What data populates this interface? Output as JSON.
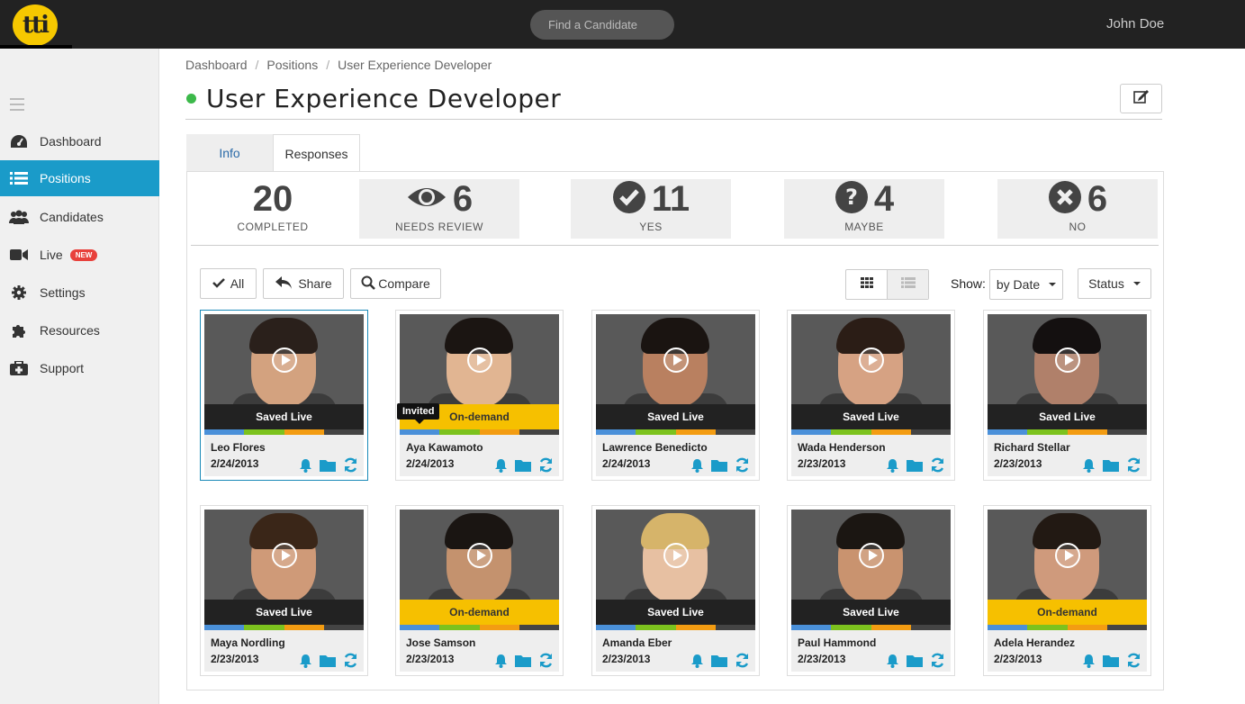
{
  "app": {
    "logo_text": "tti",
    "search_placeholder": "Find a Candidate",
    "user_name": "John Doe"
  },
  "sidebar": {
    "items": [
      {
        "label": "Dashboard",
        "icon": "dashboard-icon"
      },
      {
        "label": "Positions",
        "icon": "list-icon",
        "active": true
      },
      {
        "label": "Candidates",
        "icon": "users-icon"
      },
      {
        "label": "Live",
        "icon": "video-camera-icon",
        "badge": "NEW"
      },
      {
        "label": "Settings",
        "icon": "gear-icon"
      },
      {
        "label": "Resources",
        "icon": "puzzle-icon"
      },
      {
        "label": "Support",
        "icon": "medkit-icon"
      }
    ]
  },
  "breadcrumb": [
    "Dashboard",
    "Positions",
    "User Experience Developer"
  ],
  "page": {
    "title": "User Experience Developer",
    "status_color": "#3cb94a"
  },
  "tabs": [
    {
      "label": "Info"
    },
    {
      "label": "Responses",
      "active": true
    }
  ],
  "stats": [
    {
      "num": "20",
      "label": "COMPLETED"
    },
    {
      "num": "6",
      "label": "NEEDS REVIEW",
      "icon": "eye-icon"
    },
    {
      "num": "11",
      "label": "YES",
      "icon": "check-circle-icon"
    },
    {
      "num": "4",
      "label": "MAYBE",
      "icon": "question-circle-icon"
    },
    {
      "num": "6",
      "label": "NO",
      "icon": "x-circle-icon"
    }
  ],
  "toolbar": {
    "all_label": "All",
    "share_label": "Share",
    "compare_label": "Compare",
    "show_label": "Show:",
    "sort_value": "by Date",
    "status_label": "Status"
  },
  "colors": {
    "accent": "#1a9bc9",
    "stripe": [
      "#4a90d9",
      "#7cc21e",
      "#f39c12",
      "#444444"
    ],
    "on_demand": "#f6c000",
    "saved_live": "#222222",
    "icon": "#1a9bc9"
  },
  "tooltip": "Invited",
  "candidates": [
    {
      "name": "Leo Flores",
      "date": "2/24/2013",
      "status": "Saved Live",
      "type": "live"
    },
    {
      "name": "Aya Kawamoto",
      "date": "2/24/2013",
      "status": "On-demand",
      "type": "ondemand"
    },
    {
      "name": "Lawrence Benedicto",
      "date": "2/24/2013",
      "status": "Saved Live",
      "type": "live"
    },
    {
      "name": "Wada Henderson",
      "date": "2/23/2013",
      "status": "Saved Live",
      "type": "live"
    },
    {
      "name": "Richard Stellar",
      "date": "2/23/2013",
      "status": "Saved Live",
      "type": "live"
    },
    {
      "name": "Maya Nordling",
      "date": "2/23/2013",
      "status": "Saved Live",
      "type": "live"
    },
    {
      "name": "Jose Samson",
      "date": "2/23/2013",
      "status": "On-demand",
      "type": "ondemand"
    },
    {
      "name": "Amanda Eber",
      "date": "2/23/2013",
      "status": "Saved Live",
      "type": "live"
    },
    {
      "name": "Paul Hammond",
      "date": "2/23/2013",
      "status": "Saved Live",
      "type": "live"
    },
    {
      "name": "Adela Herandez",
      "date": "2/23/2013",
      "status": "On-demand",
      "type": "ondemand"
    }
  ]
}
